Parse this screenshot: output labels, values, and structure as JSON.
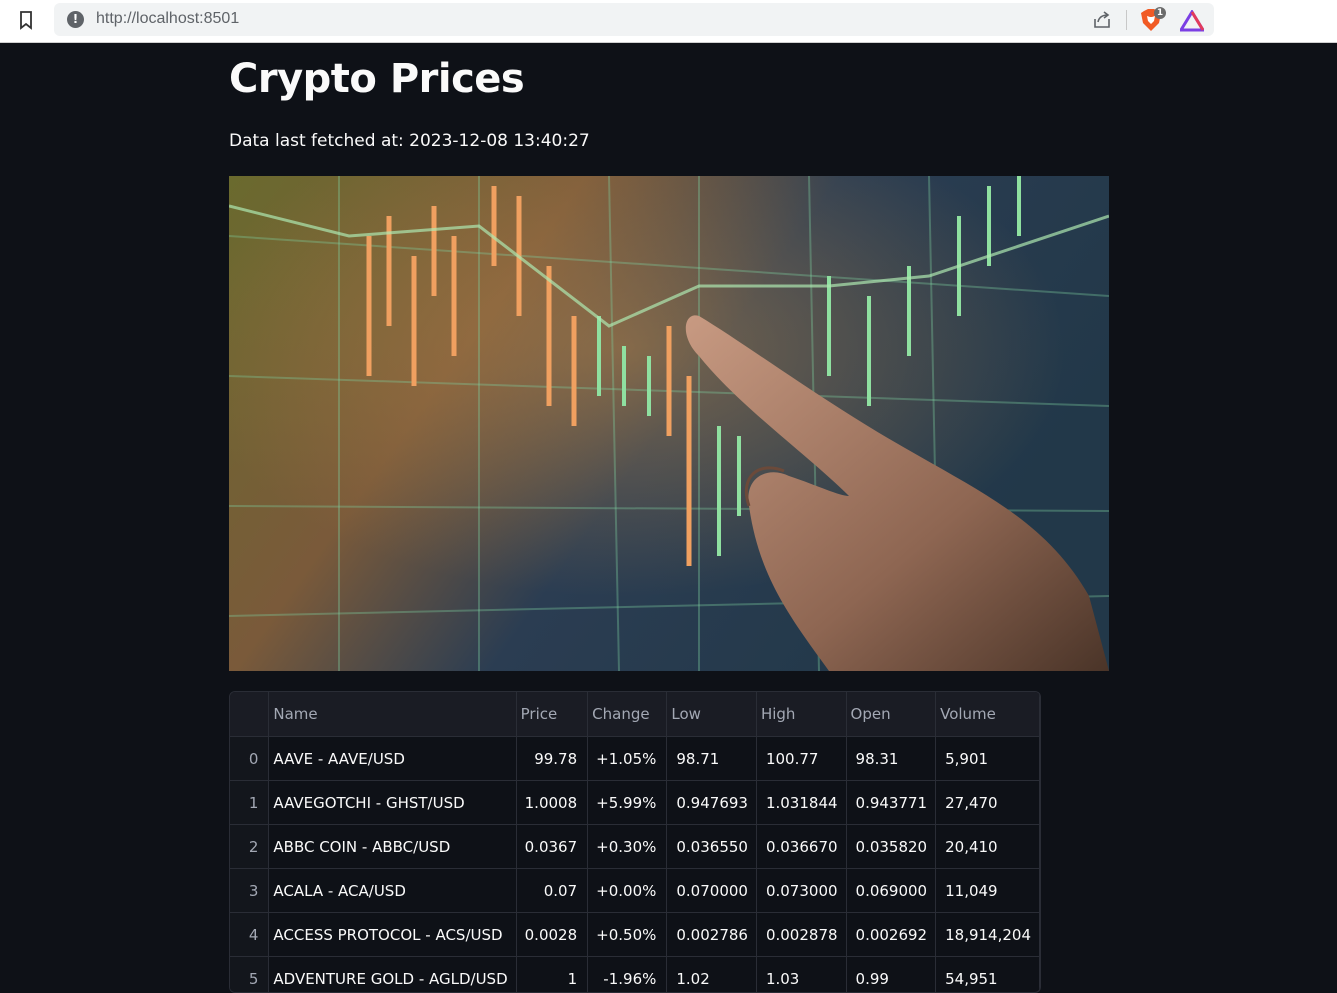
{
  "browser": {
    "url": "http://localhost:8501",
    "brave_badge": "1"
  },
  "page": {
    "title": "Crypto Prices",
    "fetched_text": "Data last fetched at: 2023-12-08 13:40:27"
  },
  "table": {
    "columns": [
      "",
      "Name",
      "Price",
      "Change",
      "Low",
      "High",
      "Open",
      "Volume"
    ],
    "rows": [
      [
        "0",
        "AAVE - AAVE/USD",
        "99.78",
        "+1.05%",
        "98.71",
        "100.77",
        "98.31",
        "5,901"
      ],
      [
        "1",
        "AAVEGOTCHI - GHST/USD",
        "1.0008",
        "+5.99%",
        "0.947693",
        "1.031844",
        "0.943771",
        "27,470"
      ],
      [
        "2",
        "ABBC COIN - ABBC/USD",
        "0.0367",
        "+0.30%",
        "0.036550",
        "0.036670",
        "0.035820",
        "20,410"
      ],
      [
        "3",
        "ACALA - ACA/USD",
        "0.07",
        "+0.00%",
        "0.070000",
        "0.073000",
        "0.069000",
        "11,049"
      ],
      [
        "4",
        "ACCESS PROTOCOL - ACS/USD",
        "0.0028",
        "+0.50%",
        "0.002786",
        "0.002878",
        "0.002692",
        "18,914,204"
      ],
      [
        "5",
        "ADVENTURE GOLD - AGLD/USD",
        "1",
        "-1.96%",
        "1.02",
        "1.03",
        "0.99",
        "54,951"
      ]
    ]
  },
  "colors": {
    "background": "#0e1117",
    "text": "#fafafa",
    "muted": "#a3a8b4",
    "border": "#2a2d36"
  }
}
